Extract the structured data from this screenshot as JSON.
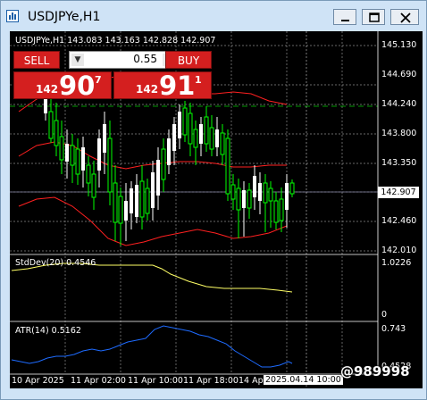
{
  "window": {
    "title": "USDJPYe,H1",
    "controls": [
      "minimize-icon",
      "maximize-icon",
      "close-icon"
    ]
  },
  "chart": {
    "header": "USDJPYe,H1  143.083 143.163 142.828 142.907",
    "price_axis": [
      "145.130",
      "144.690",
      "144.240",
      "143.800",
      "143.350",
      "142.907",
      "142.460",
      "142.010"
    ],
    "current_price": "142.907",
    "time_axis": [
      "10 Apr 2025",
      "11 Apr 02:00",
      "11 Apr 10:00",
      "11 Apr 18:00",
      "14 Ap"
    ],
    "time_cursor_label": "2025.04.14 10:00",
    "colors": {
      "background": "#000000",
      "bull": "#ffffff",
      "bear": "#00ff00",
      "envelope": "#ff0000",
      "stddev": "#ffff66",
      "atr": "#1e6bff",
      "grid": "#ffffff"
    }
  },
  "trade_panel": {
    "sell_label": "SELL",
    "buy_label": "BUY",
    "lot_value": "0.55",
    "lot_down": "▼",
    "lot_up": "▲",
    "sell_quote": {
      "big_figure": "142",
      "pips": "90",
      "fraction": "7"
    },
    "buy_quote": {
      "big_figure": "142",
      "pips": "91",
      "fraction": "1"
    }
  },
  "stddev_panel": {
    "label": "StdDev(20) 0.4546",
    "axis_max": "1.0226",
    "axis_min": "0"
  },
  "atr_panel": {
    "label": "ATR(14) 0.5162",
    "axis_max": "0.743",
    "axis_mid": "0.4528"
  },
  "watermark": "@989998"
}
